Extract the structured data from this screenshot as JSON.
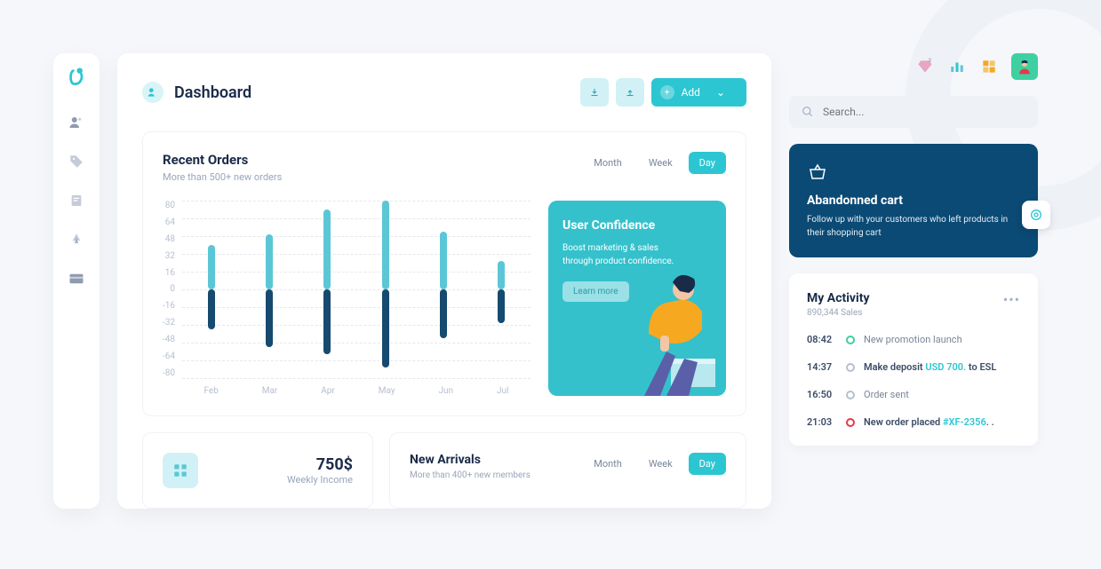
{
  "header": {
    "title": "Dashboard",
    "add_label": "Add"
  },
  "search": {
    "placeholder": "Search..."
  },
  "orders": {
    "title": "Recent Orders",
    "subtitle": "More than 500+ new orders",
    "tabs": {
      "month": "Month",
      "week": "Week",
      "day": "Day"
    }
  },
  "promo": {
    "title": "User Confidence",
    "line1": "Boost marketing & sales",
    "line2": "through product confidence.",
    "cta": "Learn more"
  },
  "income": {
    "value": "750$",
    "label": "Weekly Income"
  },
  "arrivals": {
    "title": "New Arrivals",
    "subtitle": "More than 400+ new members",
    "tabs": {
      "month": "Month",
      "week": "Week",
      "day": "Day"
    }
  },
  "cart": {
    "title": "Abandonned cart",
    "text": "Follow up with your customers who left products in their shopping cart"
  },
  "activity": {
    "title": "My Activity",
    "subtitle": "890,344 Sales",
    "items": [
      {
        "time": "08:42",
        "color": "#3fd0a2",
        "text": "New promotion launch"
      },
      {
        "time": "14:37",
        "color": "#b6bfcf",
        "prefix": "Make deposit ",
        "link": "USD 700.",
        "suffix": " to ESL"
      },
      {
        "time": "16:50",
        "color": "#b6bfcf",
        "text": "Order sent"
      },
      {
        "time": "21:03",
        "color": "#e63946",
        "prefix": "New order placed ",
        "link": "#XF-2356",
        "suffix": ". ."
      }
    ]
  },
  "chart_data": {
    "type": "bar",
    "title": "Recent Orders",
    "ylabel": "",
    "xlabel": "",
    "ylim": [
      -80,
      80
    ],
    "y_ticks": [
      80,
      64,
      48,
      32,
      16,
      0,
      -16,
      -32,
      -48,
      -64,
      -80
    ],
    "categories": [
      "Feb",
      "Mar",
      "Apr",
      "May",
      "Jun",
      "Jul"
    ],
    "series": [
      {
        "name": "positive",
        "values": [
          40,
          50,
          72,
          80,
          52,
          26
        ],
        "color": "#5bc7d6"
      },
      {
        "name": "negative",
        "values": [
          -36,
          -52,
          -58,
          -70,
          -44,
          -30
        ],
        "color": "#164a6f"
      }
    ]
  }
}
